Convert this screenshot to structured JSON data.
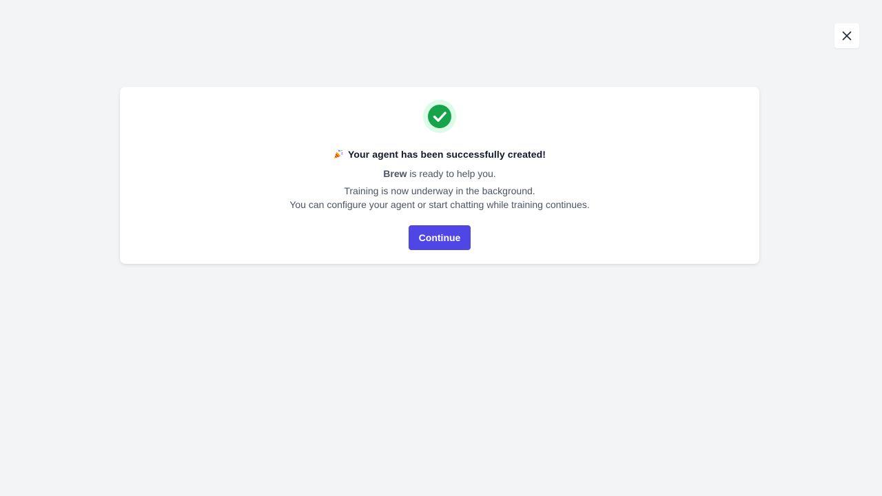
{
  "close_button": {
    "icon": "close-icon"
  },
  "modal": {
    "status_icon": "check-circle-icon",
    "title_emoji_icon": "party-popper-icon",
    "title": "Your agent has been successfully created!",
    "agent_name": "Brew",
    "ready_text": " is ready to help you.",
    "training_text": "Training is now underway in the background.",
    "configure_text": "You can configure your agent or start chatting while training continues.",
    "continue_label": "Continue"
  },
  "colors": {
    "page_bg": "#f3f4f6",
    "success": "#16a34a",
    "success_halo": "#dcfce7",
    "primary": "#4f46e5"
  }
}
